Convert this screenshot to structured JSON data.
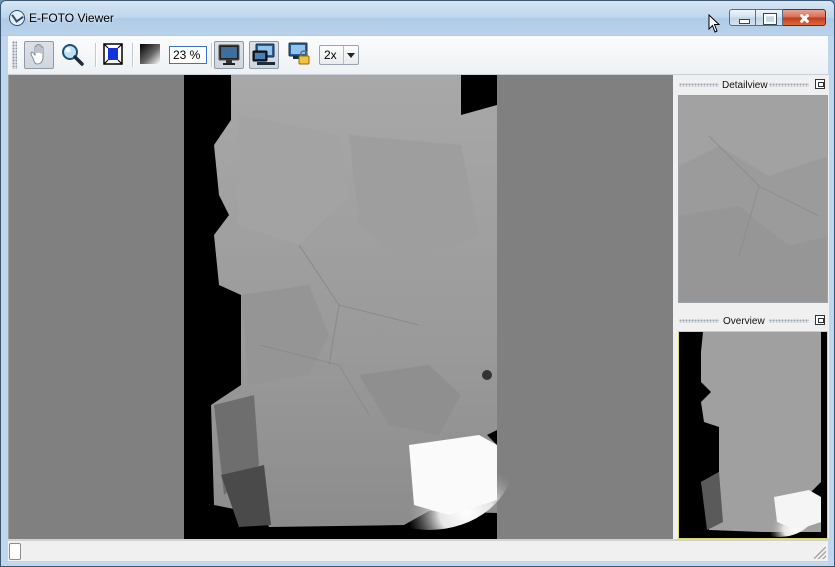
{
  "window": {
    "title": "E-FOTO Viewer",
    "icon": "efoto-logo-icon"
  },
  "toolbar": {
    "tools": [
      {
        "name": "pan-tool",
        "icon": "hand-icon",
        "pressed": true
      },
      {
        "name": "zoom-tool",
        "icon": "magnifier-icon",
        "pressed": false
      },
      {
        "name": "fit-view",
        "icon": "fit-to-view-icon",
        "pressed": false
      },
      {
        "name": "contrast-tool",
        "icon": "gradient-icon",
        "pressed": false
      },
      {
        "name": "detail-view-toggle",
        "icon": "monitor-icon",
        "pressed": true
      },
      {
        "name": "overview-toggle",
        "icon": "monitor-network-icon",
        "pressed": true
      },
      {
        "name": "lock-view",
        "icon": "monitor-lock-icon",
        "pressed": false
      }
    ],
    "zoom_value": "23 %",
    "detail_scale": "2x"
  },
  "docks": {
    "detail": {
      "title": "Detailview"
    },
    "overview": {
      "title": "Overview"
    }
  },
  "colors": {
    "background": "#808080",
    "image_black": "#000000",
    "overview_border": "#d8d86a"
  }
}
